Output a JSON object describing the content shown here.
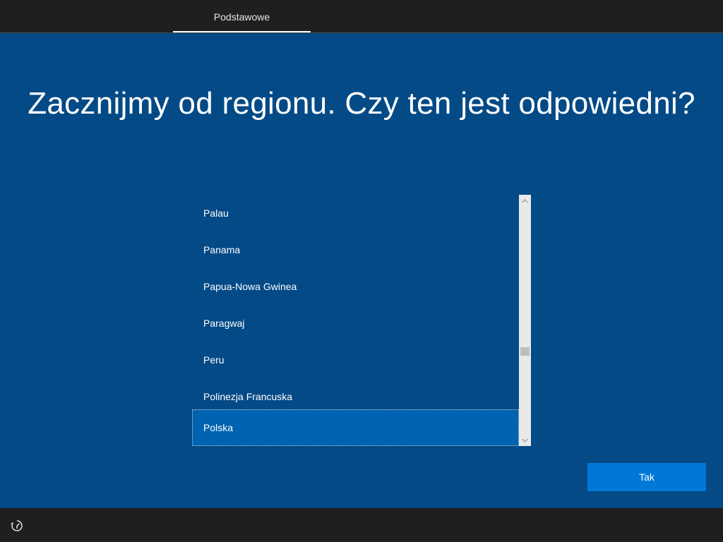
{
  "topbar": {
    "tab_label": "Podstawowe"
  },
  "heading": "Zacznijmy od regionu. Czy ten jest odpowiedni?",
  "region_list": {
    "items": [
      {
        "label": "Palau",
        "selected": false
      },
      {
        "label": "Panama",
        "selected": false
      },
      {
        "label": "Papua-Nowa Gwinea",
        "selected": false
      },
      {
        "label": "Paragwaj",
        "selected": false
      },
      {
        "label": "Peru",
        "selected": false
      },
      {
        "label": "Polinezja Francuska",
        "selected": false
      },
      {
        "label": "Polska",
        "selected": true
      }
    ]
  },
  "buttons": {
    "confirm_label": "Tak"
  },
  "icons": {
    "scroll_up": "chevron-up-icon",
    "scroll_down": "chevron-down-icon",
    "accessibility": "ease-of-access-icon"
  },
  "colors": {
    "background": "#034a86",
    "bar": "#1f1f1f",
    "selection": "#0063b1",
    "button": "#0078d7"
  }
}
